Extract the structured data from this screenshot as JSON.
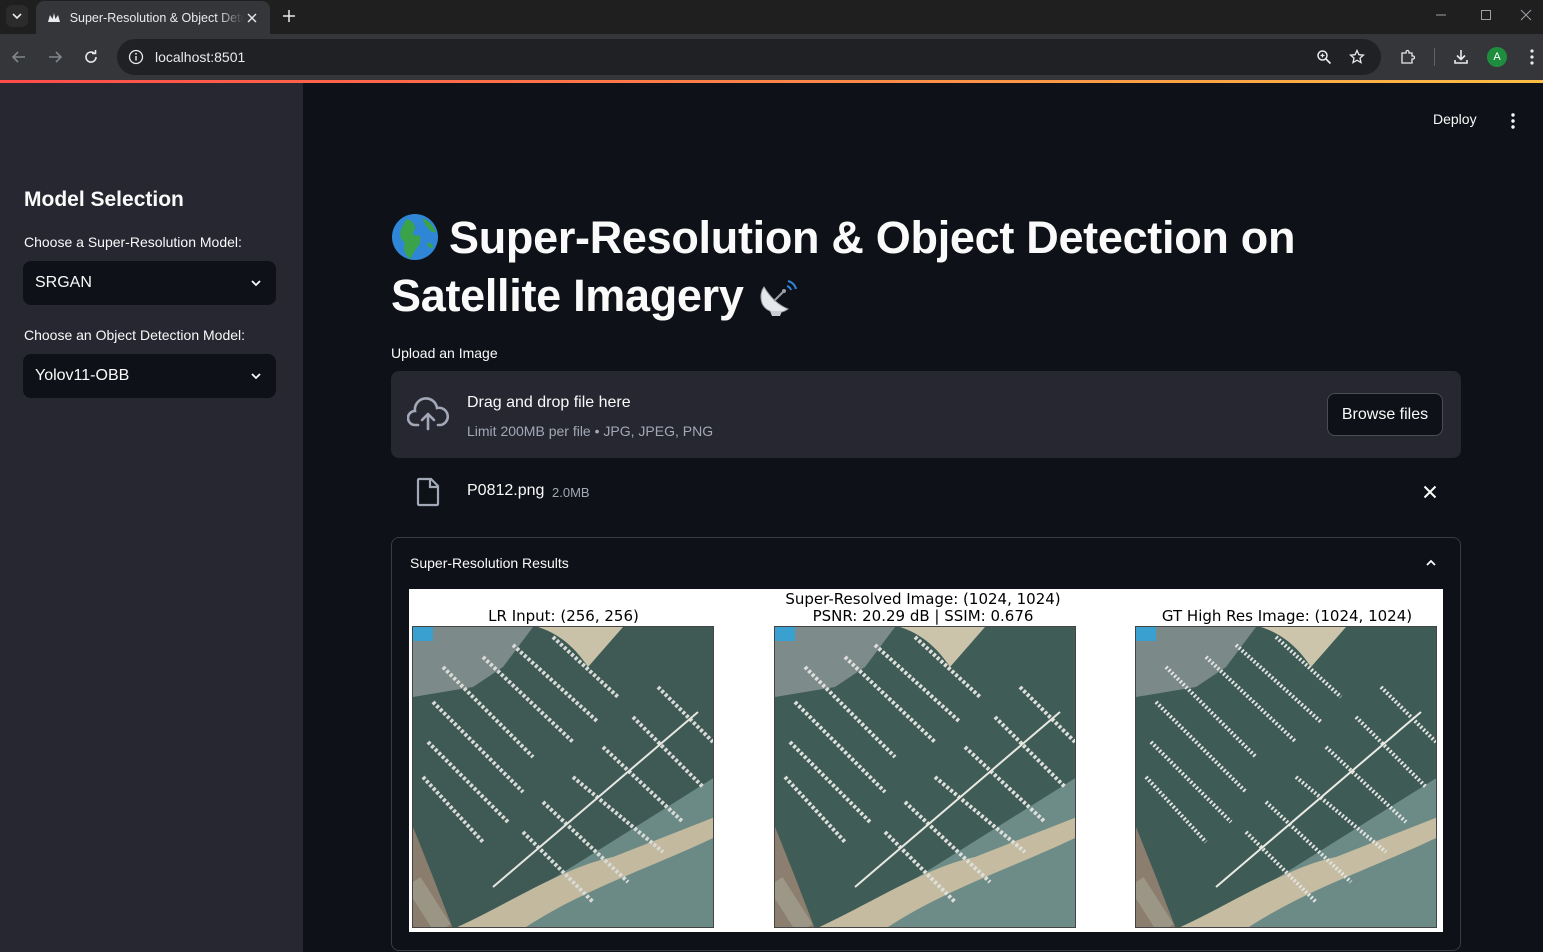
{
  "browser": {
    "tab_title": "Super-Resolution & Object Detection on Satellite Imagery",
    "url": "localhost:8501",
    "profile_initial": "A"
  },
  "app": {
    "deploy_label": "Deploy",
    "title_line1": "Super-Resolution & Object Detection on",
    "title_line2": "Satellite Imagery",
    "title_icons": [
      "globe-icon",
      "satellite-dish-icon"
    ]
  },
  "sidebar": {
    "heading": "Model Selection",
    "sr_label": "Choose a Super-Resolution Model:",
    "sr_value": "SRGAN",
    "od_label": "Choose an Object Detection Model:",
    "od_value": "Yolov11-OBB"
  },
  "uploader": {
    "label": "Upload an Image",
    "drop_text": "Drag and drop file here",
    "limit_text": "Limit 200MB per file • JPG, JPEG, PNG",
    "browse_label": "Browse files",
    "file_name": "P0812.png",
    "file_size": "2.0MB"
  },
  "results": {
    "expander_title": "Super-Resolution Results",
    "captions": {
      "lr": "LR Input: (256, 256)",
      "sr_line1": "Super-Resolved Image: (1024, 1024)",
      "sr_line2": "PSNR: 20.29 dB | SSIM: 0.676",
      "gt": "GT High Res Image: (1024, 1024)"
    }
  },
  "colors": {
    "app_bg": "#0e1117",
    "sidebar_bg": "#262730",
    "accent_red": "#ff4b4b",
    "accent_yellow": "#ffbd45"
  }
}
